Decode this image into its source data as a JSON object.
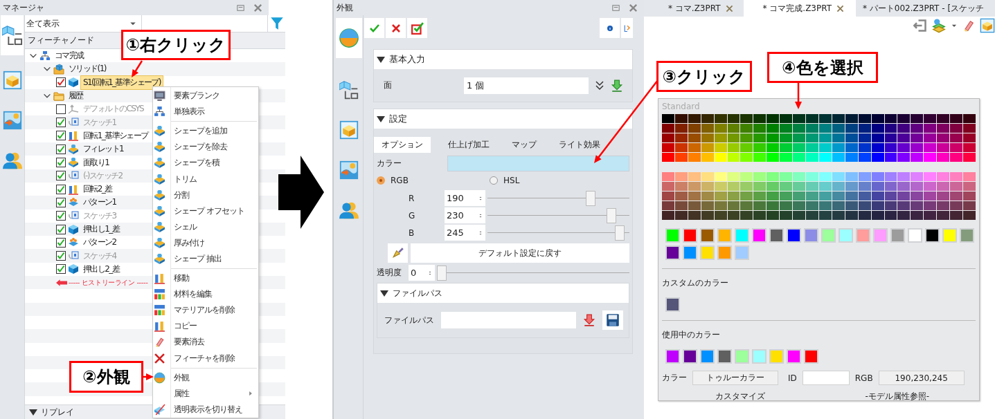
{
  "manager": {
    "title": "マネージャ",
    "filter": {
      "value": "全て表示"
    },
    "column_header": "フィーチャノード",
    "tree": [
      {
        "label": "コマ完成",
        "kind": "assembly",
        "expanded": true,
        "selected": false,
        "children": [
          {
            "label": "ソリッド(1)",
            "kind": "solid-folder",
            "expanded": true,
            "selected": false,
            "children": [
              {
                "label": "S1(回転1_基準シェープ)",
                "kind": "solid",
                "checked": true,
                "dimmed": false,
                "selected": true
              }
            ]
          },
          {
            "label": "履歴",
            "kind": "folder",
            "expanded": true,
            "selected": false,
            "end_marker": "----- ヒストリーライン -----",
            "children": [
              {
                "label": "デフォルトのCSYS",
                "kind": "csys",
                "checked": false,
                "dimmed": true,
                "selected": false
              },
              {
                "label": "スケッチ1",
                "kind": "sketch",
                "checked": true,
                "dimmed": true,
                "selected": false
              },
              {
                "label": "回転1_基準シェープ",
                "kind": "revolve",
                "checked": true,
                "dimmed": false,
                "selected": false
              },
              {
                "label": "フィレット1",
                "kind": "fillet",
                "checked": true,
                "dimmed": false,
                "selected": false
              },
              {
                "label": "面取り1",
                "kind": "chamfer",
                "checked": true,
                "dimmed": false,
                "selected": false
              },
              {
                "label": "(-)スケッチ2",
                "kind": "sketch",
                "checked": true,
                "dimmed": true,
                "selected": false
              },
              {
                "label": "回転2_差",
                "kind": "revolve",
                "checked": true,
                "dimmed": false,
                "selected": false
              },
              {
                "label": "パターン1",
                "kind": "pattern",
                "checked": true,
                "dimmed": false,
                "selected": false
              },
              {
                "label": "スケッチ3",
                "kind": "sketch",
                "checked": true,
                "dimmed": true,
                "selected": false
              },
              {
                "label": "押出し1_差",
                "kind": "extrude",
                "checked": true,
                "dimmed": false,
                "selected": false
              },
              {
                "label": "パターン2",
                "kind": "pattern",
                "checked": true,
                "dimmed": false,
                "selected": false
              },
              {
                "label": "スケッチ4",
                "kind": "sketch",
                "checked": true,
                "dimmed": true,
                "selected": false
              },
              {
                "label": "押出し2_差",
                "kind": "extrude",
                "checked": true,
                "dimmed": false,
                "selected": false
              }
            ]
          }
        ]
      }
    ],
    "bottom_section": "リプレイ"
  },
  "context_menu": {
    "groups": [
      {
        "items": [
          {
            "label": "要素ブランク",
            "submenu": false
          },
          {
            "label": "単独表示",
            "submenu": false
          }
        ]
      },
      {
        "items": [
          {
            "label": "シェープを追加",
            "submenu": false
          },
          {
            "label": "シェープを除去",
            "submenu": false
          },
          {
            "label": "シェープを積",
            "submenu": false
          },
          {
            "label": "トリム",
            "submenu": false
          },
          {
            "label": "分割",
            "submenu": false
          },
          {
            "label": "シェープ オフセット",
            "submenu": false
          },
          {
            "label": "シェル",
            "submenu": false
          },
          {
            "label": "厚み付け",
            "submenu": false
          },
          {
            "label": "シェープ 抽出",
            "submenu": false
          }
        ]
      },
      {
        "items": [
          {
            "label": "移動",
            "submenu": false
          },
          {
            "label": "材料を編集",
            "submenu": false
          },
          {
            "label": "マテリアルを削除",
            "submenu": false
          },
          {
            "label": "コピー",
            "submenu": false
          },
          {
            "label": "要素消去",
            "submenu": false
          },
          {
            "label": "フィーチャを削除",
            "submenu": false
          }
        ]
      },
      {
        "items": [
          {
            "label": "外観",
            "submenu": false
          },
          {
            "label": "属性",
            "submenu": true
          },
          {
            "label": "透明表示を切り替え",
            "submenu": false
          }
        ]
      }
    ]
  },
  "appearance": {
    "title": "外観",
    "basic_input": {
      "title": "基本入力",
      "expanded": true,
      "label": "面",
      "value": "1 個"
    },
    "settings": {
      "title": "設定",
      "expanded": true,
      "tabs": [
        {
          "label": "オプション",
          "selected": true
        },
        {
          "label": "仕上げ加工",
          "selected": false
        },
        {
          "label": "マップ",
          "selected": false
        },
        {
          "label": "ライト効果",
          "selected": false
        }
      ],
      "color_label": "カラー",
      "color_modes": [
        {
          "label": "RGB",
          "selected": true
        },
        {
          "label": "HSL",
          "selected": false
        }
      ],
      "channels": [
        {
          "label": "R",
          "value": "190",
          "level": 0.745
        },
        {
          "label": "G",
          "value": "230",
          "level": 0.902
        },
        {
          "label": "B",
          "value": "245",
          "level": 0.961
        }
      ],
      "reset_button": "デフォルト設定に戻す",
      "transparency": {
        "label": "透明度",
        "value": "0",
        "level": 0
      },
      "file_path": {
        "title": "ファイルパス",
        "expanded": true,
        "label": "ファイルパス"
      }
    }
  },
  "documents": {
    "tabs": [
      {
        "label": "* コマ.Z3PRT",
        "selected": false,
        "closable": true
      },
      {
        "label": "* コマ完成.Z3PRT",
        "selected": true,
        "closable": true
      },
      {
        "label": "* パート002.Z3PRT - [スケッチ",
        "selected": false,
        "closable": false
      }
    ]
  },
  "palette": {
    "title": "Standard",
    "quick_colors": [
      {
        "color": "#00ff00"
      },
      {
        "color": "#ff0000"
      },
      {
        "color": "#9c5a00"
      },
      {
        "color": "#ffb400"
      },
      {
        "color": "#00ffff"
      },
      {
        "color": "#ff00ff"
      },
      {
        "color": "#606060"
      },
      {
        "color": "#0000ff"
      },
      {
        "color": "#8c8ce6"
      },
      {
        "color": "#9cff9c"
      },
      {
        "color": "#9cffff"
      },
      {
        "color": "#ff9c9c"
      },
      {
        "color": "#ff9cff"
      },
      {
        "color": "#9c9c9c"
      },
      {
        "color": "#ffffff"
      },
      {
        "color": "#000000"
      },
      {
        "color": "#ffff00"
      },
      {
        "color": "#849c7c"
      },
      {
        "color": "#660099"
      },
      {
        "color": "#0090ff"
      },
      {
        "color": "#ffe000"
      },
      {
        "color": "#ff9900"
      },
      {
        "color": "#a0ccff"
      }
    ],
    "custom_title": "カスタムのカラー",
    "custom_colors": [
      {
        "color": "#55557a"
      }
    ],
    "used_title": "使用中のカラー",
    "used_colors": [
      {
        "color": "#c000ff"
      },
      {
        "color": "#660099"
      },
      {
        "color": "#0090ff"
      },
      {
        "color": "#606060"
      },
      {
        "color": "#9cff9c"
      },
      {
        "color": "#9cffff"
      },
      {
        "color": "#ffe000"
      },
      {
        "color": "#ff00ff"
      },
      {
        "color": "#ff0000"
      }
    ],
    "color_label": "カラー",
    "color_type": "トゥルーカラー",
    "id_label": "ID",
    "rgb_label": "RGB",
    "rgb_value": "190,230,245",
    "buttons": [
      "カスタマイズ",
      "-モデル属性参照-"
    ]
  },
  "annotations": [
    "①右クリック",
    "②外観",
    "③クリック",
    "④色を選択"
  ]
}
